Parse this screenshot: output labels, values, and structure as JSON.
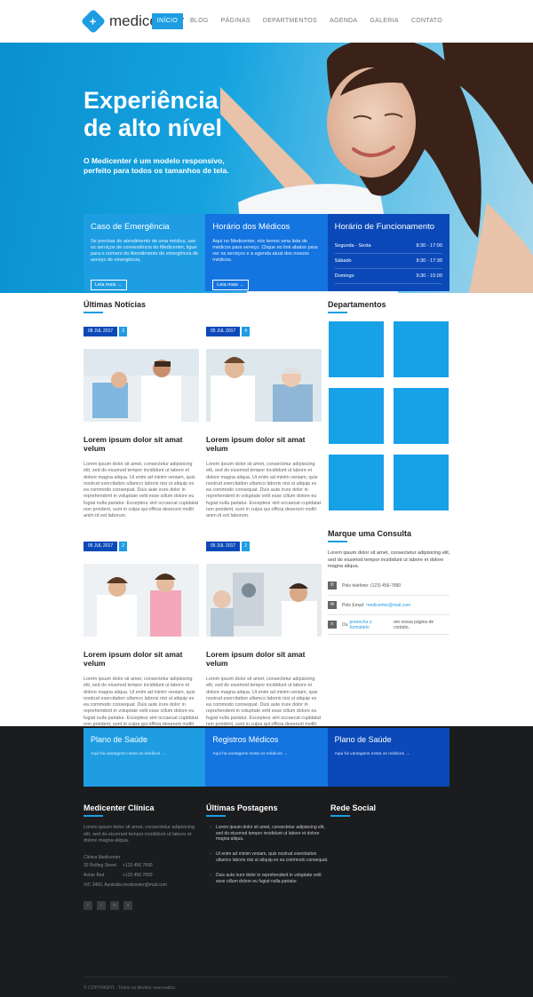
{
  "brand": {
    "name": "medicenter"
  },
  "nav": [
    "INÍCIO",
    "BLOG",
    "PÁGINAS",
    "DEPARTMENTOS",
    "AGENDA",
    "GALERIA",
    "CONTATO"
  ],
  "hero": {
    "title": "Experiência de alto nível",
    "subtitle": "O Medicenter é um modelo responsivo, perfeito para todos os tamanhos de tela."
  },
  "info_boxes": {
    "emergency": {
      "title": "Caso de Emergência",
      "text": "Se precisar do atendimento de uma médica, use os serviços de conveniência do Medicenter, ligue para o número do Atendimento de emergência de serviço de emergência.",
      "button": "Leia mais →"
    },
    "doctors": {
      "title": "Horário dos Médicos",
      "text": "Aqui no Medicenter, nós temos uma lista de médicos para serviço. Clique no link abaixo para ver os serviços e a agenda atual dos nossos médicos.",
      "button": "Leia mais →"
    },
    "hours": {
      "title": "Horário de Funcionamento",
      "rows": [
        {
          "day": "Segunda - Sexta",
          "time": "8:30 - 17:00"
        },
        {
          "day": "Sábado",
          "time": "9:30 - 17:30"
        },
        {
          "day": "Domingo",
          "time": "9:30 - 15:00"
        }
      ]
    }
  },
  "news": {
    "title": "Últimas Notícias",
    "posts": [
      {
        "date": "08 JUL 2017",
        "comments": "3",
        "title": "Lorem ipsum dolor sit amat velum",
        "text": "Lorem ipsum dolor sit amet, consectetur adipisicing elit, sed do eiusmod tempor incididunt ut labore et dolore magna aliqua. Ut enim ad minim veniam, quis nostrud exercitation ullamco laboris nisi ut aliquip ex ea commodo consequat. Duis aute irure dolor in reprehenderit in voluptate velit esse cillum dolore eu fugiat nulla pariatur. Excepteur sint occaecat cupidatat non proident, sunt in culpa qui officia deserunt mollit anim id est laborum."
      },
      {
        "date": "05 JUL 2017",
        "comments": "4",
        "title": "Lorem ipsum dolor sit amat velum",
        "text": "Lorem ipsum dolor sit amet, consectetur adipisicing elit, sed do eiusmod tempor incididunt ut labore et dolore magna aliqua. Ut enim ad minim veniam, quis nostrud exercitation ullamco laboris nisi ut aliquip ex ea commodo consequat. Duis aute irure dolor in reprehenderit in voluptate velit esse cillum dolore eu fugiat nulla pariatur. Excepteur sint occaecat cupidatat non proident, sunt in culpa qui officia deserunt mollit anim id est laborum."
      },
      {
        "date": "05 JUL 2017",
        "comments": "2",
        "title": "Lorem ipsum dolor sit amat velum",
        "text": "Lorem ipsum dolor sit amet, consectetur adipisicing elit, sed do eiusmod tempor incididunt ut labore et dolore magna aliqua. Ut enim ad minim veniam, quis nostrud exercitation ullamco laboris nisi ut aliquip ex ea commodo consequat. Duis aute irure dolor in reprehenderit in voluptate velit esse cillum dolore eu fugiat nulla pariatur. Excepteur sint occaecat cupidatat non proident, sunt in culpa qui officia deserunt mollit anim id est laborum."
      },
      {
        "date": "05 JUL 2017",
        "comments": "2",
        "title": "Lorem ipsum dolor sit amat velum",
        "text": "Lorem ipsum dolor sit amet, consectetur adipisicing elit, sed do eiusmod tempor incididunt ut labore et dolore magna aliqua. Ut enim ad minim veniam, quis nostrud exercitation ullamco laboris nisi ut aliquip ex ea commodo consequat. Duis aute irure dolor in reprehenderit in voluptate velit esse cillum dolore eu fugiat nulla pariatur. Excepteur sint occaecat cupidatat non proident, sunt in culpa qui officia deserunt mollit anim id est laborum."
      }
    ]
  },
  "departments": {
    "title": "Departamentos"
  },
  "consult": {
    "title": "Marque uma Consulta",
    "text": "Lorem ipsum dolor sit amet, consectetur adipisicing elit, sed do eiusmod tempor incididunt ut labore et dolore magna aliqua.",
    "phone_label": "Pelo telefone:",
    "phone": "(123) 456-7890",
    "email_label": "Pelo Email:",
    "email": "medicenter@mail.com",
    "form_pre": "Ou",
    "form_link": "preencha o formulário",
    "form_post": "em nossa página de contato."
  },
  "footer_bands": [
    {
      "title": "Plano de Saúde",
      "text": "Aqui há vantagens nesta os médicos →"
    },
    {
      "title": "Registros Médicos",
      "text": "Aqui há vantagens nesta os médicos →"
    },
    {
      "title": "Plano de Saúde",
      "text": "Aqui há vantagens nesta os médicos →"
    }
  ],
  "footer": {
    "about_title": "Medicenter Clínica",
    "about_text": "Lorem ipsum dolor sit amet, consectetur adipisicing elit, sed do eiusmod tempor incididunt ut labore et dolore magna aliqua.",
    "contact_heading": "Clínica Medicenter",
    "contact": [
      {
        "k": "33 Rolling Street",
        "v": "+123 456 7890"
      },
      {
        "k": "Ashar Bad",
        "v": "+123 456 7890"
      },
      {
        "k": "VIC 3400, Austrália",
        "v": "medicenter@mail.com"
      }
    ],
    "posts_title": "Últimas Postagens",
    "posts": [
      "Lorem ipsum dolor sit amet, consectetur adipisicing elit, sed do eiusmod tempor incididunt ut labore et dolore magna aliqua.",
      "Ut enim ad minim veniam, quis nostrud exercitation ullamco laboris nisi ut aliquip ex ea commodo consequat.",
      "Duis aute irure dolor in reprehenderit in voluptate velit esse cillum dolore eu fugiat nulla pariatur."
    ],
    "social_title": "Rede Social",
    "copyright": "© COPYRIGHT - Todos os direitos reservados."
  },
  "colors": {
    "accent": "#1e9de3",
    "blue_mid": "#1474e0",
    "blue_dark": "#0b49b8",
    "footer_bg": "#1b1c1e"
  },
  "icons": [
    "logo-cross-icon",
    "phone-icon",
    "mail-icon",
    "form-icon",
    "facebook-icon",
    "twitter-icon",
    "linkedin-icon",
    "skype-icon"
  ]
}
